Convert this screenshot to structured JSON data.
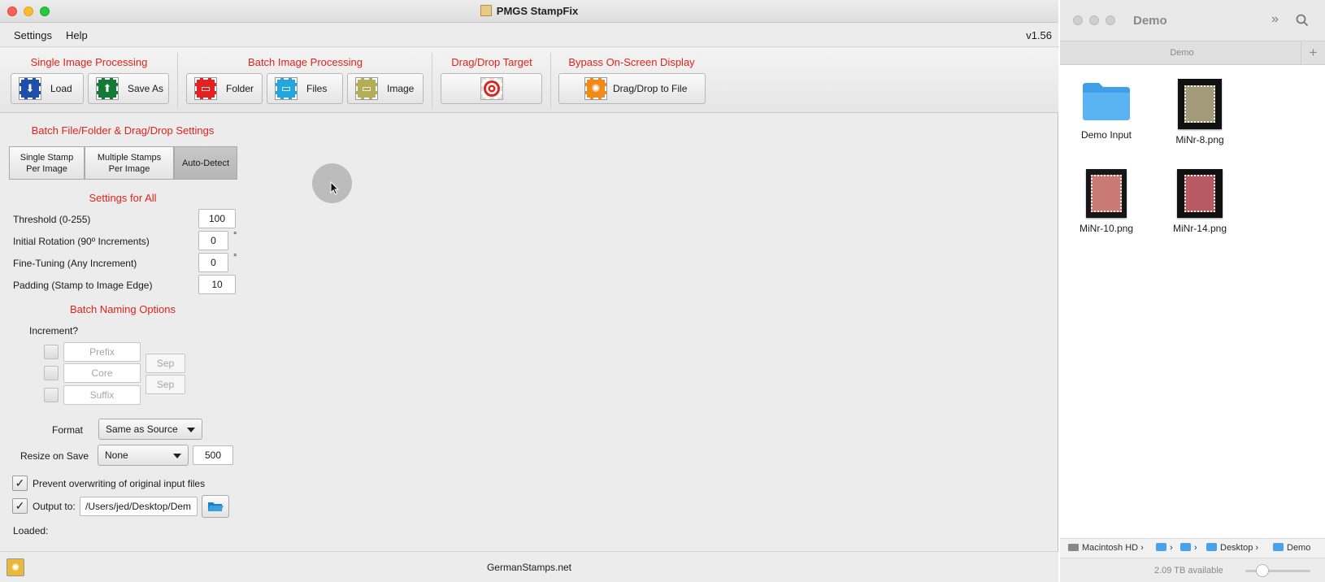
{
  "app": {
    "title": "PMGS StampFix",
    "menu": [
      "Settings",
      "Help"
    ],
    "version": "v1.56",
    "colors": {
      "accent_red": "#e0231b",
      "folder_blue": "#4aa3e8"
    }
  },
  "toolbar": {
    "single": {
      "title": "Single Image Processing",
      "load": "Load",
      "save_as": "Save As"
    },
    "batch": {
      "title": "Batch Image Processing",
      "folder": "Folder",
      "files": "Files",
      "image": "Image"
    },
    "dragdrop": {
      "title": "Drag/Drop Target"
    },
    "bypass": {
      "title": "Bypass On-Screen Display",
      "button": "Drag/Drop to File"
    }
  },
  "batch_settings": {
    "title": "Batch File/Folder & Drag/Drop Settings",
    "modes": [
      {
        "line1": "Single Stamp",
        "line2": "Per Image"
      },
      {
        "line1": "Multiple Stamps",
        "line2": "Per Image"
      },
      {
        "line1": "Auto-Detect",
        "line2": ""
      }
    ],
    "active_mode": "Auto-Detect"
  },
  "settings_all": {
    "title": "Settings for All",
    "rows": [
      {
        "label": "Threshold (0-255)",
        "value": "100",
        "unit": ""
      },
      {
        "label": "Initial Rotation (90º Increments)",
        "value": "0",
        "unit": "°"
      },
      {
        "label": "Fine-Tuning (Any Increment)",
        "value": "0",
        "unit": "°"
      },
      {
        "label": "Padding (Stamp to Image Edge)",
        "value": "10",
        "unit": ""
      }
    ]
  },
  "naming": {
    "title": "Batch Naming Options",
    "increment_label": "Increment?",
    "prefix_placeholder": "Prefix",
    "core_placeholder": "Core",
    "suffix_placeholder": "Suffix",
    "sep1": "Sep",
    "sep2": "Sep"
  },
  "output": {
    "format_label": "Format",
    "format_value": "Same as Source",
    "resize_label": "Resize on Save",
    "resize_value": "None",
    "resize_size": "500",
    "prevent_overwrite_label": "Prevent overwriting of original input files",
    "prevent_overwrite_checked": true,
    "output_to_label": "Output to:",
    "output_to_checked": true,
    "output_path": "/Users/jed/Desktop/Dem",
    "loaded_label": "Loaded:"
  },
  "status": {
    "site": "GermanStamps.net"
  },
  "finder": {
    "title": "Demo",
    "tab": "Demo",
    "items": [
      {
        "name": "Demo Input",
        "kind": "folder-icon"
      },
      {
        "name": "MiNr-8.png",
        "kind": "stamp-image",
        "color": "#a39a7a"
      },
      {
        "name": "MiNr-10.png",
        "kind": "stamp-image",
        "color": "#c97a73"
      },
      {
        "name": "MiNr-14.png",
        "kind": "stamp-image",
        "color": "#b85a61"
      }
    ],
    "path": [
      "Macintosh HD",
      "",
      "",
      "Desktop",
      "Demo"
    ],
    "available": "2.09 TB available"
  }
}
